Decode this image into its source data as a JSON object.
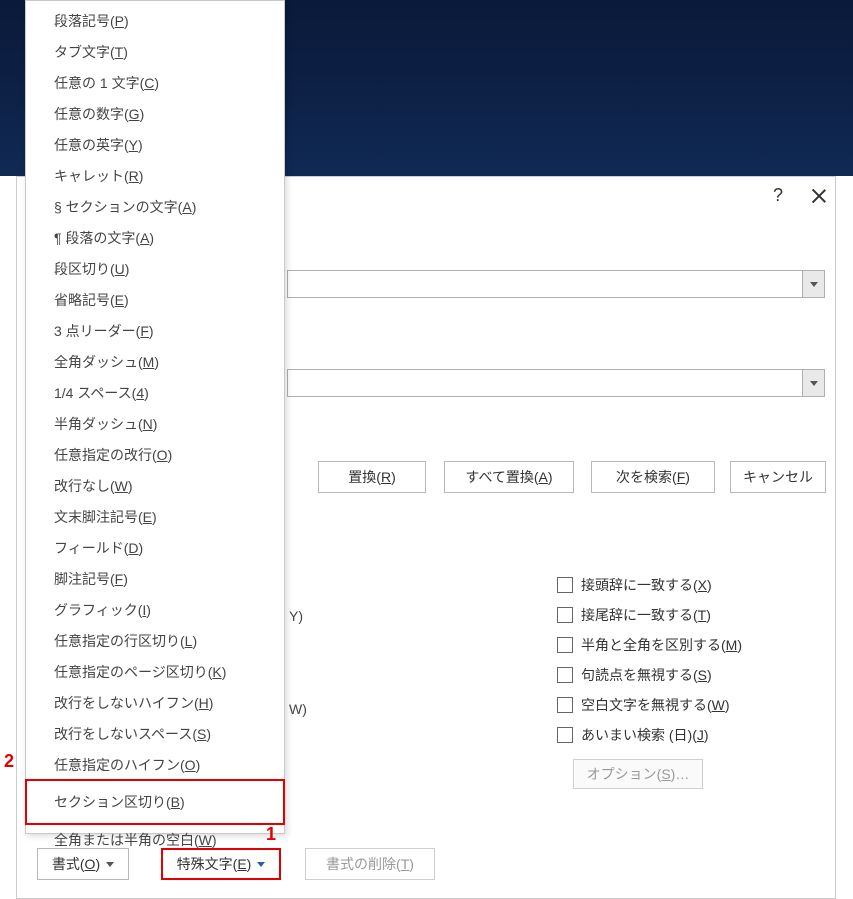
{
  "dialog": {
    "help_tooltip": "?",
    "buttons": {
      "replace": "置換(R)",
      "replace_all": "すべて置換(A)",
      "find_next": "次を検索(F)",
      "cancel": "キャンセル"
    },
    "partials": {
      "y": "Y)",
      "w": "W)"
    },
    "checks": [
      "接頭辞に一致する(X)",
      "接尾辞に一致する(T)",
      "半角と全角を区別する(M)",
      "句読点を無視する(S)",
      "空白文字を無視する(W)",
      "あいまい検索 (日)(J)"
    ],
    "options_btn": "オプション(S)…",
    "format_btn": "書式(O)",
    "special_btn": "特殊文字(E)",
    "clear_format_btn": "書式の削除(T)"
  },
  "menu": {
    "items": [
      "段落記号(P)",
      "タブ文字(T)",
      "任意の 1 文字(C)",
      "任意の数字(G)",
      "任意の英字(Y)",
      "キャレット(R)",
      "§ セクションの文字(A)",
      "¶ 段落の文字(A)",
      "段区切り(U)",
      "省略記号(E)",
      "3 点リーダー(F)",
      "全角ダッシュ(M)",
      "1/4 スペース(4)",
      "半角ダッシュ(N)",
      "任意指定の改行(O)",
      "改行なし(W)",
      "文末脚注記号(E)",
      "フィールド(D)",
      "脚注記号(F)",
      "グラフィック(I)",
      "任意指定の行区切り(L)",
      "任意指定のページ区切り(K)",
      "改行をしないハイフン(H)",
      "改行をしないスペース(S)",
      "任意指定のハイフン(O)",
      "セクション区切り(B)",
      "全角または半角の空白(W)"
    ]
  },
  "annotations": {
    "one": "1",
    "two": "2"
  }
}
